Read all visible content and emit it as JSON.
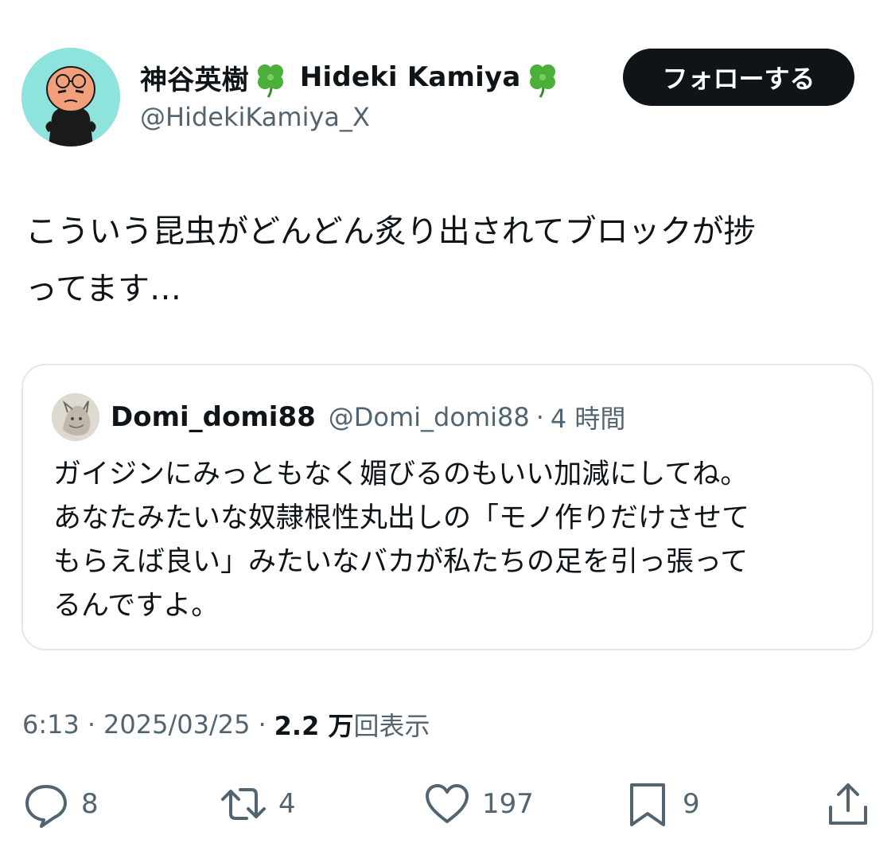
{
  "author": {
    "display_name": "神谷英樹",
    "display_name_latin": "Hideki Kamiya",
    "handle": "@HidekiKamiya_X",
    "avatar_icon": "cartoon-avatar-icon",
    "emoji_icon": "four-leaf-clover-icon"
  },
  "follow_button": {
    "label": "フォローする"
  },
  "tweet": {
    "lines": [
      "こういう昆虫がどんどん炙り出されてブロックが捗",
      "ってます…"
    ]
  },
  "quote": {
    "name": "Domi_domi88",
    "handle": "@Domi_domi88",
    "separator": "·",
    "time": "4 時間",
    "lines": [
      "ガイジンにみっともなく媚びるのもいい加減にしてね。",
      "あなたみたいな奴隷根性丸出しの「モノ作りだけさせて",
      "もらえば良い」みたいなバカが私たちの足を引っ張って",
      "るんですよ。"
    ]
  },
  "meta": {
    "time": "6:13",
    "separator": "·",
    "date": "2025/03/25",
    "views_count": "2.2 万",
    "views_label": "回表示"
  },
  "actions": {
    "reply": {
      "icon": "reply-icon",
      "count": "8"
    },
    "retweet": {
      "icon": "retweet-icon",
      "count": "4"
    },
    "like": {
      "icon": "heart-icon",
      "count": "197"
    },
    "bookmark": {
      "icon": "bookmark-icon",
      "count": "9"
    },
    "share": {
      "icon": "share-icon"
    }
  },
  "colors": {
    "text": "#0f1419",
    "secondary_text": "#536471",
    "follow_button_bg": "#0f1419",
    "card_border": "#e1e8ed",
    "avatar_bg": "#8ee3dc"
  }
}
